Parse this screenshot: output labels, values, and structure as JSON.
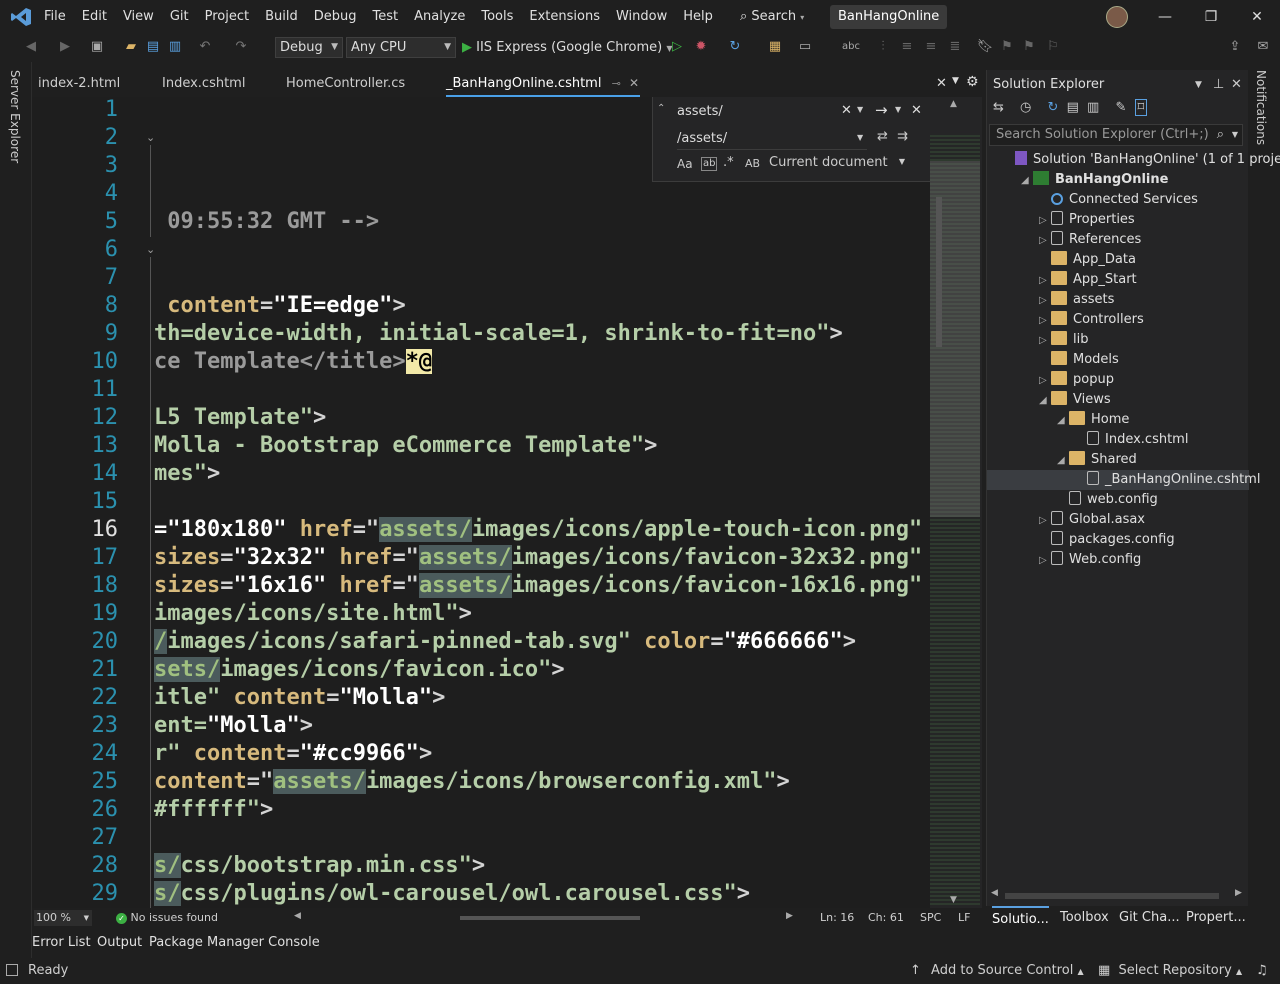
{
  "menu": [
    "File",
    "Edit",
    "View",
    "Git",
    "Project",
    "Build",
    "Debug",
    "Test",
    "Analyze",
    "Tools",
    "Extensions",
    "Window",
    "Help"
  ],
  "search_label": "Search",
  "solution_name": "BanHangOnline",
  "toolbar": {
    "config": "Debug",
    "platform": "Any CPU",
    "run_target": "IIS Express (Google Chrome)"
  },
  "left_rail_label": "Server Explorer",
  "right_rail_label": "Notifications",
  "tabs": [
    "index-2.html",
    "Index.cshtml",
    "HomeController.cs",
    "_BanHangOnline.cshtml"
  ],
  "find": {
    "search_value": "assets/",
    "replace_value": "/assets/",
    "scope": "Current document",
    "opt_case": "Aa",
    "opt_word": "ab",
    "opt_regex": ".*",
    "opt_preserve": "AB"
  },
  "editor": {
    "current_line": 16,
    "lines": [
      {
        "n": "1",
        "parts": []
      },
      {
        "n": "2",
        "parts": []
      },
      {
        "n": "3",
        "parts": []
      },
      {
        "n": "4",
        "parts": []
      },
      {
        "n": "5",
        "parts": [
          {
            "c": "c-cmt",
            "t": " 09:55:32 GMT -->"
          }
        ]
      },
      {
        "n": "6",
        "parts": []
      },
      {
        "n": "7",
        "parts": []
      },
      {
        "n": "8",
        "parts": [
          {
            "c": "c-attr",
            "t": " content"
          },
          {
            "c": "",
            "t": "="
          },
          {
            "c": "c-str",
            "t": "\"IE=edge\""
          },
          {
            "c": "",
            "t": ">"
          }
        ]
      },
      {
        "n": "9",
        "parts": [
          {
            "c": "c-txt",
            "t": "th=device-width, initial-scale=1, shrink-to-fit=no\""
          },
          {
            "c": "",
            "t": ">"
          }
        ]
      },
      {
        "n": "10",
        "parts": [
          {
            "c": "c-cmt",
            "t": "ce Template</title>"
          },
          {
            "c": "c-at",
            "t": "*@"
          }
        ]
      },
      {
        "n": "11",
        "parts": []
      },
      {
        "n": "12",
        "parts": [
          {
            "c": "c-txt",
            "t": "L5 Template\""
          },
          {
            "c": "",
            "t": ">"
          }
        ]
      },
      {
        "n": "13",
        "parts": [
          {
            "c": "c-txt",
            "t": "Molla - Bootstrap eCommerce Template\""
          },
          {
            "c": "",
            "t": ">"
          }
        ]
      },
      {
        "n": "14",
        "parts": [
          {
            "c": "c-txt",
            "t": "mes\""
          },
          {
            "c": "",
            "t": ">"
          }
        ]
      },
      {
        "n": "15",
        "parts": []
      },
      {
        "n": "16",
        "parts": [
          {
            "c": "c-str",
            "t": "=\"180x180\" "
          },
          {
            "c": "c-attr",
            "t": "href"
          },
          {
            "c": "",
            "t": "=\""
          },
          {
            "c": "c-hl",
            "t": "assets/"
          },
          {
            "c": "c-txt",
            "t": "images/icons/apple-touch-icon.png\""
          }
        ]
      },
      {
        "n": "17",
        "parts": [
          {
            "c": "c-attr",
            "t": "sizes"
          },
          {
            "c": "",
            "t": "="
          },
          {
            "c": "c-str",
            "t": "\"32x32\" "
          },
          {
            "c": "c-attr",
            "t": "href"
          },
          {
            "c": "",
            "t": "=\""
          },
          {
            "c": "c-hl",
            "t": "assets/"
          },
          {
            "c": "c-txt",
            "t": "images/icons/favicon-32x32.png\""
          }
        ]
      },
      {
        "n": "18",
        "parts": [
          {
            "c": "c-attr",
            "t": "sizes"
          },
          {
            "c": "",
            "t": "="
          },
          {
            "c": "c-str",
            "t": "\"16x16\" "
          },
          {
            "c": "c-attr",
            "t": "href"
          },
          {
            "c": "",
            "t": "=\""
          },
          {
            "c": "c-hl",
            "t": "assets/"
          },
          {
            "c": "c-txt",
            "t": "images/icons/favicon-16x16.png\""
          }
        ]
      },
      {
        "n": "19",
        "parts": [
          {
            "c": "c-txt",
            "t": "images/icons/site.html\""
          },
          {
            "c": "",
            "t": ">"
          }
        ]
      },
      {
        "n": "20",
        "parts": [
          {
            "c": "c-hl",
            "t": "/"
          },
          {
            "c": "c-txt",
            "t": "images/icons/safari-pinned-tab.svg\" "
          },
          {
            "c": "c-attr",
            "t": "color"
          },
          {
            "c": "",
            "t": "="
          },
          {
            "c": "c-str",
            "t": "\"#666666\""
          },
          {
            "c": "",
            "t": ">"
          }
        ]
      },
      {
        "n": "21",
        "parts": [
          {
            "c": "c-hl",
            "t": "sets/"
          },
          {
            "c": "c-txt",
            "t": "images/icons/favicon.ico\""
          },
          {
            "c": "",
            "t": ">"
          }
        ]
      },
      {
        "n": "22",
        "parts": [
          {
            "c": "c-txt",
            "t": "itle\" "
          },
          {
            "c": "c-attr",
            "t": "content"
          },
          {
            "c": "",
            "t": "="
          },
          {
            "c": "c-str",
            "t": "\"Molla\""
          },
          {
            "c": "",
            "t": ">"
          }
        ]
      },
      {
        "n": "23",
        "parts": [
          {
            "c": "c-txt",
            "t": "ent="
          },
          {
            "c": "c-str",
            "t": "\"Molla\""
          },
          {
            "c": "",
            "t": ">"
          }
        ]
      },
      {
        "n": "24",
        "parts": [
          {
            "c": "c-txt",
            "t": "r\" "
          },
          {
            "c": "c-attr",
            "t": "content"
          },
          {
            "c": "",
            "t": "="
          },
          {
            "c": "c-str",
            "t": "\"#cc9966\""
          },
          {
            "c": "",
            "t": ">"
          }
        ]
      },
      {
        "n": "25",
        "parts": [
          {
            "c": "c-attr",
            "t": "content"
          },
          {
            "c": "",
            "t": "=\""
          },
          {
            "c": "c-hl",
            "t": "assets/"
          },
          {
            "c": "c-txt",
            "t": "images/icons/browserconfig.xml\""
          },
          {
            "c": "",
            "t": ">"
          }
        ]
      },
      {
        "n": "26",
        "parts": [
          {
            "c": "c-txt",
            "t": "#ffffff\""
          },
          {
            "c": "",
            "t": ">"
          }
        ]
      },
      {
        "n": "27",
        "parts": []
      },
      {
        "n": "28",
        "parts": [
          {
            "c": "c-hl",
            "t": "s/"
          },
          {
            "c": "c-txt",
            "t": "css/bootstrap.min.css\""
          },
          {
            "c": "",
            "t": ">"
          }
        ]
      },
      {
        "n": "29",
        "parts": [
          {
            "c": "c-hl",
            "t": "s/"
          },
          {
            "c": "c-txt",
            "t": "css/plugins/owl-carousel/owl.carousel.css\""
          },
          {
            "c": "",
            "t": ">"
          }
        ]
      }
    ]
  },
  "editor_status": {
    "zoom": "100 %",
    "issues": "No issues found",
    "line": "Ln: 16",
    "col": "Ch: 61",
    "whitespace": "SPC",
    "eol": "LF"
  },
  "bottom_tabs": [
    "Error List",
    "Output",
    "Package Manager Console"
  ],
  "status": {
    "ready": "Ready",
    "source_control": "Add to Source Control",
    "repository": "Select Repository"
  },
  "solution_explorer": {
    "title": "Solution Explorer",
    "search_placeholder": "Search Solution Explorer (Ctrl+;)",
    "items": [
      {
        "label": "Solution 'BanHangOnline' (1 of 1 proje",
        "indent": 0,
        "toggle": "",
        "icon": "solution-icon"
      },
      {
        "label": "BanHangOnline",
        "indent": 1,
        "toggle": "◢",
        "icon": "project-icon",
        "bold": true
      },
      {
        "label": "Connected Services",
        "indent": 2,
        "toggle": "",
        "icon": "connected-services-icon"
      },
      {
        "label": "Properties",
        "indent": 2,
        "toggle": "▷",
        "icon": "wrench-icon"
      },
      {
        "label": "References",
        "indent": 2,
        "toggle": "▷",
        "icon": "references-icon"
      },
      {
        "label": "App_Data",
        "indent": 2,
        "toggle": "",
        "icon": "folder-icon"
      },
      {
        "label": "App_Start",
        "indent": 2,
        "toggle": "▷",
        "icon": "folder-icon"
      },
      {
        "label": "assets",
        "indent": 2,
        "toggle": "▷",
        "icon": "folder-icon"
      },
      {
        "label": "Controllers",
        "indent": 2,
        "toggle": "▷",
        "icon": "folder-icon"
      },
      {
        "label": "lib",
        "indent": 2,
        "toggle": "▷",
        "icon": "folder-icon"
      },
      {
        "label": "Models",
        "indent": 2,
        "toggle": "",
        "icon": "folder-icon"
      },
      {
        "label": "popup",
        "indent": 2,
        "toggle": "▷",
        "icon": "folder-icon"
      },
      {
        "label": "Views",
        "indent": 2,
        "toggle": "◢",
        "icon": "folder-icon"
      },
      {
        "label": "Home",
        "indent": 3,
        "toggle": "◢",
        "icon": "folder-icon"
      },
      {
        "label": "Index.cshtml",
        "indent": 4,
        "toggle": "",
        "icon": "razor-file-icon"
      },
      {
        "label": "Shared",
        "indent": 3,
        "toggle": "◢",
        "icon": "folder-icon"
      },
      {
        "label": "_BanHangOnline.cshtml",
        "indent": 4,
        "toggle": "",
        "icon": "razor-file-icon",
        "selected": true
      },
      {
        "label": "web.config",
        "indent": 3,
        "toggle": "",
        "icon": "config-file-icon"
      },
      {
        "label": "Global.asax",
        "indent": 2,
        "toggle": "▷",
        "icon": "config-file-icon"
      },
      {
        "label": "packages.config",
        "indent": 2,
        "toggle": "",
        "icon": "config-file-icon"
      },
      {
        "label": "Web.config",
        "indent": 2,
        "toggle": "▷",
        "icon": "config-file-icon"
      }
    ],
    "bottom_tabs": [
      "Solutio...",
      "Toolbox",
      "Git Cha...",
      "Propert..."
    ]
  }
}
